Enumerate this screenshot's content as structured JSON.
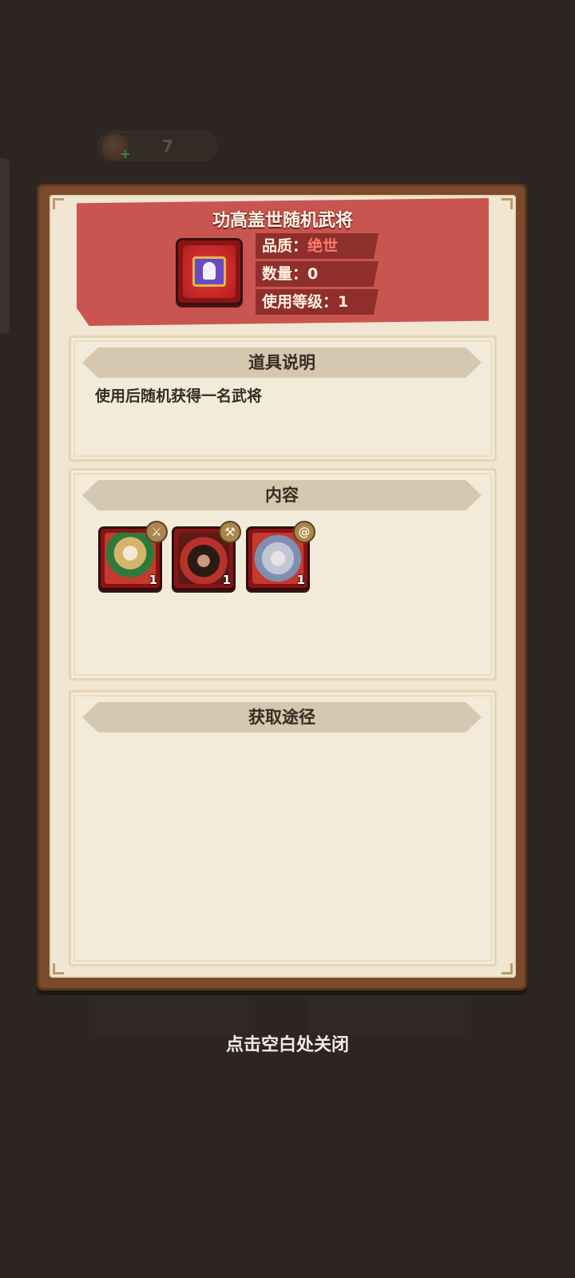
{
  "top_bar": {
    "currency_value": "7"
  },
  "item": {
    "title": "功高盖世随机武将",
    "icon": "hero-chest-icon",
    "quality_label": "品质：",
    "quality_value": "绝世",
    "quantity_label": "数量：",
    "quantity_value": "0",
    "level_label": "使用等级：",
    "level_value": "1"
  },
  "description": {
    "header": "道具说明",
    "text": "使用后随机获得一名武将"
  },
  "contents": {
    "header": "内容",
    "heroes": [
      {
        "name_icon": "hero-portrait-green-helmet-icon",
        "class_icon": "sword-class-icon",
        "count": "1"
      },
      {
        "name_icon": "hero-portrait-red-warrior-icon",
        "class_icon": "axe-class-icon",
        "count": "1"
      },
      {
        "name_icon": "hero-portrait-white-sage-icon",
        "class_icon": "spiral-class-icon",
        "count": "1"
      }
    ]
  },
  "obtain": {
    "header": "获取途径"
  },
  "close_hint": "点击空白处关闭",
  "colors": {
    "backdrop": "#2c2521",
    "banner": "#c95550",
    "paper": "#f0e6d2",
    "quality_red": "#ff7a6c"
  }
}
